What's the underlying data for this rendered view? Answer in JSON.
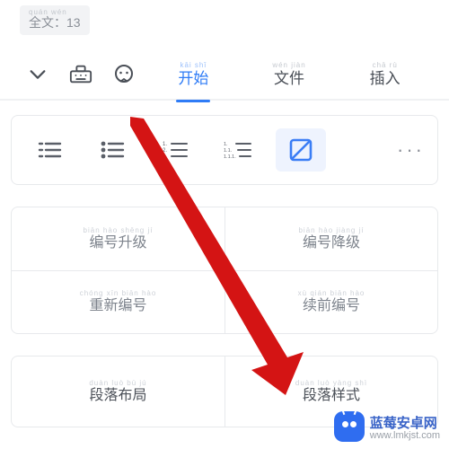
{
  "top_chip": {
    "pinyin": "quán wén",
    "label": "全文：13"
  },
  "tabs": {
    "start": {
      "pinyin": "kāi shǐ",
      "label": "开始"
    },
    "file": {
      "pinyin": "wén jiàn",
      "label": "文件"
    },
    "insert": {
      "pinyin": "chā rù",
      "label": "插入"
    }
  },
  "toolbar": {
    "bullet_list": "bullet-list",
    "dot_list": "dot-list",
    "numbered_list": "numbered-list",
    "multilevel_list": "multilevel-list",
    "none": "none",
    "more": "···"
  },
  "numbering_grid": {
    "promote": {
      "pinyin": "biān hào shēng jí",
      "label": "编号升级"
    },
    "demote": {
      "pinyin": "biān hào jiàng jí",
      "label": "编号降级"
    },
    "restart": {
      "pinyin": "chóng xīn biān hào",
      "label": "重新编号"
    },
    "continue": {
      "pinyin": "xù qián biān hào",
      "label": "续前编号"
    }
  },
  "bottom": {
    "para_layout": {
      "pinyin": "duàn luò bù jú",
      "label": "段落布局"
    },
    "para_style": {
      "pinyin": "duàn luò yàng shì",
      "label": "段落样式"
    }
  },
  "watermark": {
    "title": "蓝莓安卓网",
    "url": "www.lmkjst.com"
  }
}
